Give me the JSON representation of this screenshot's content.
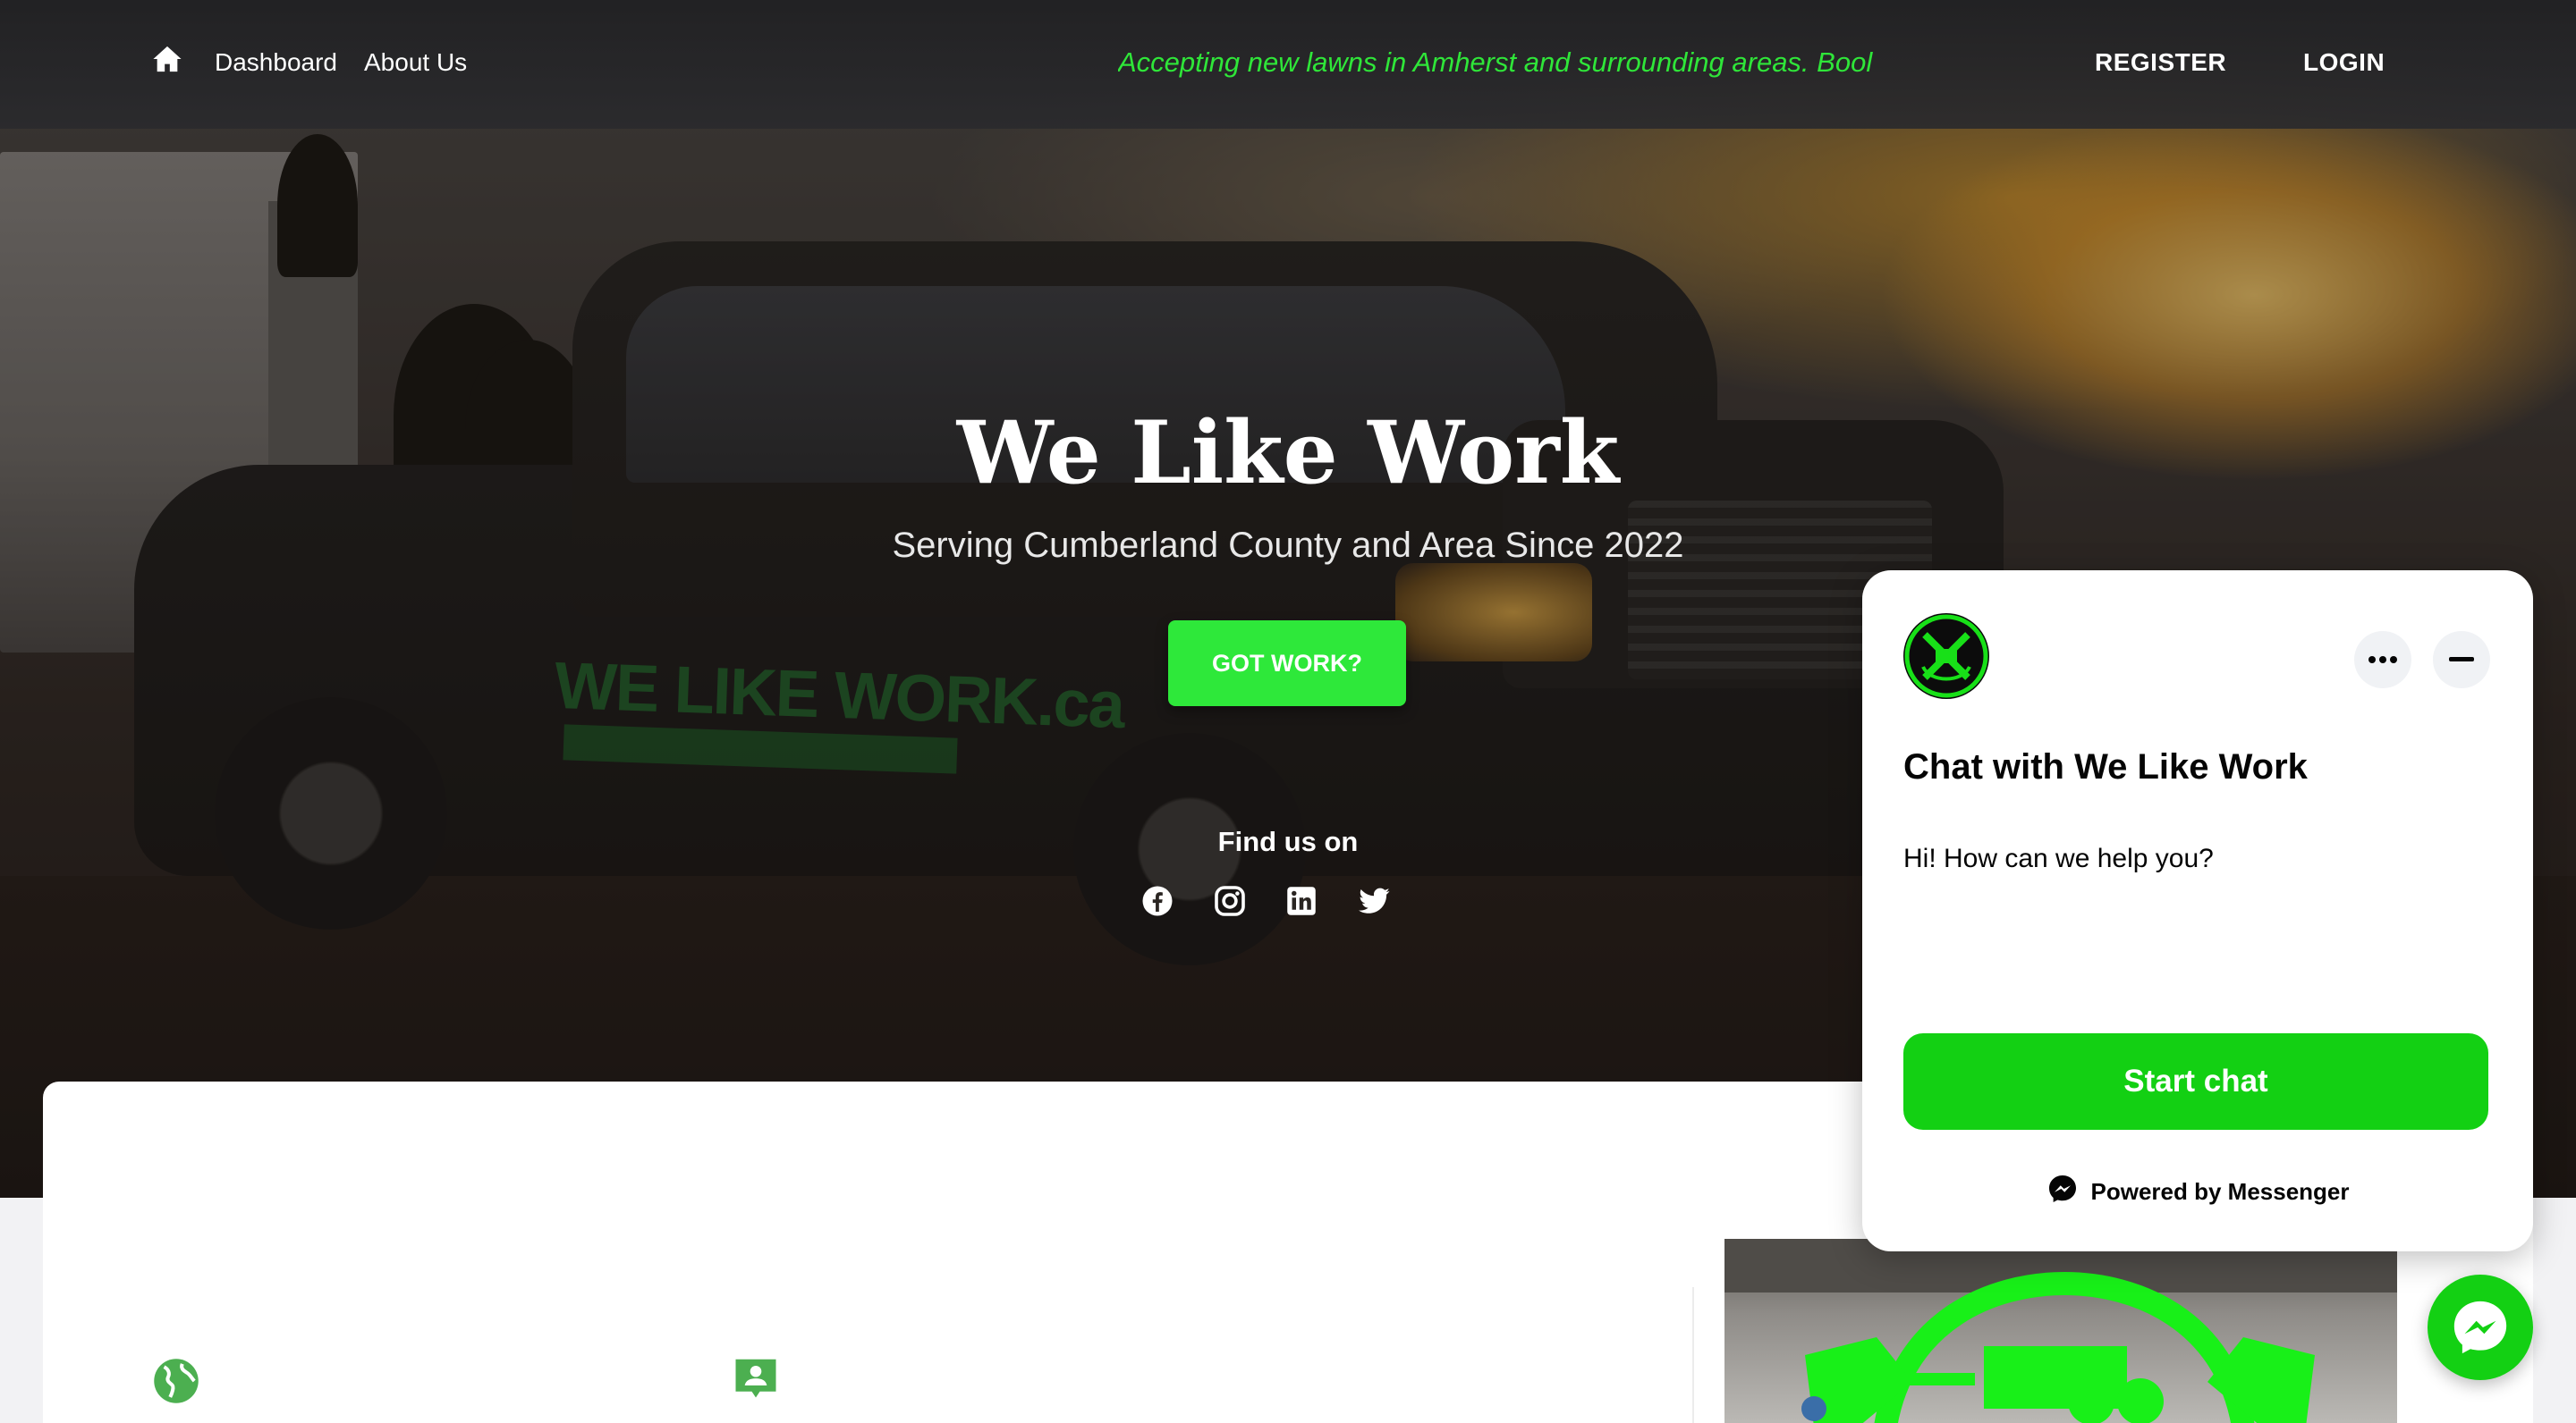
{
  "nav": {
    "links": [
      {
        "label": "Dashboard"
      },
      {
        "label": "About Us"
      }
    ],
    "announcement": "Accepting new lawns in Amherst and surrounding areas. Bool",
    "register_label": "REGISTER",
    "login_label": "LOGIN"
  },
  "hero": {
    "title": "We Like Work",
    "subtitle": "Serving Cumberland County and Area Since 2022",
    "cta_label": "GOT WORK?",
    "find_us_label": "Find us on",
    "decal_text": "WE LIKE WORK.ca",
    "social_icons": [
      "facebook-icon",
      "instagram-icon",
      "linkedin-icon",
      "twitter-icon"
    ]
  },
  "chat_widget": {
    "title": "Chat with We Like Work",
    "greeting": "Hi! How can we help you?",
    "start_label": "Start chat",
    "powered_label": "Powered by Messenger"
  },
  "colors": {
    "accent_green": "#2ee83a",
    "messenger_green": "#13d013",
    "announcement_green": "#2fe639",
    "nav_bg": "#222224"
  }
}
